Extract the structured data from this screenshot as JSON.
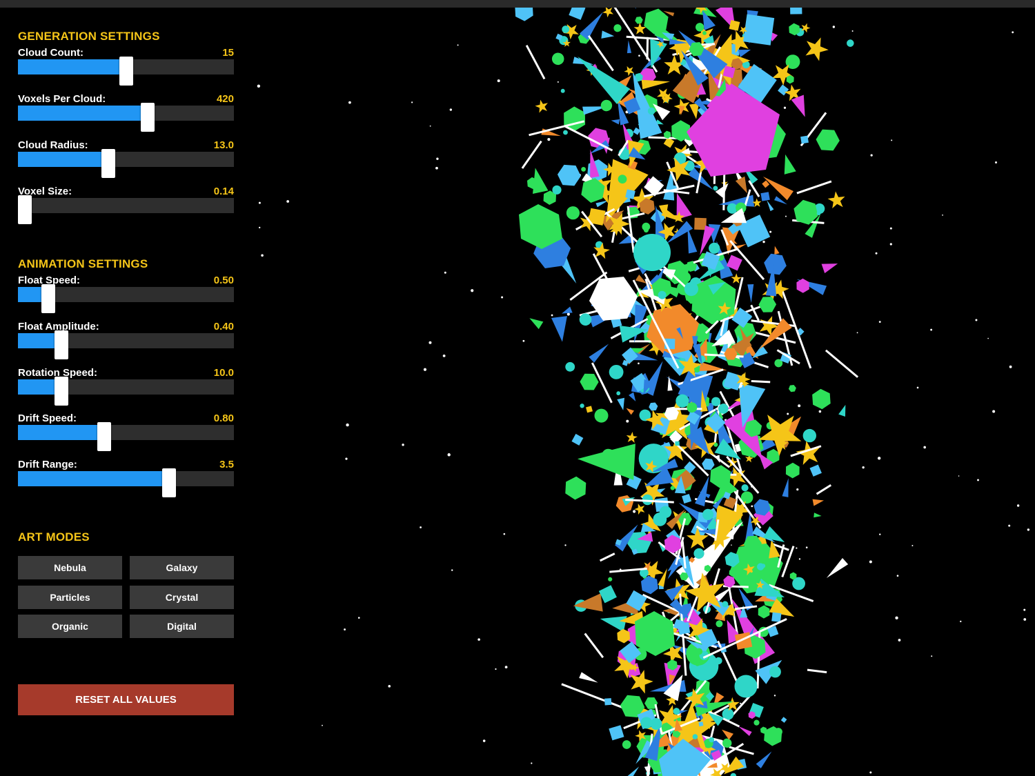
{
  "generation": {
    "title": "GENERATION SETTINGS",
    "sliders": [
      {
        "label": "Cloud Count:",
        "value": "15",
        "fraction": 0.5
      },
      {
        "label": "Voxels Per Cloud:",
        "value": "420",
        "fraction": 0.6
      },
      {
        "label": "Cloud Radius:",
        "value": "13.0",
        "fraction": 0.42
      },
      {
        "label": "Voxel Size:",
        "value": "0.14",
        "fraction": 0.02
      }
    ]
  },
  "animation": {
    "title": "ANIMATION SETTINGS",
    "sliders": [
      {
        "label": "Float Speed:",
        "value": "0.50",
        "fraction": 0.14
      },
      {
        "label": "Float Amplitude:",
        "value": "0.40",
        "fraction": 0.2
      },
      {
        "label": "Rotation Speed:",
        "value": "10.0",
        "fraction": 0.2
      },
      {
        "label": "Drift Speed:",
        "value": "0.80",
        "fraction": 0.4
      },
      {
        "label": "Drift Range:",
        "value": "3.5",
        "fraction": 0.7
      }
    ]
  },
  "art_modes": {
    "title": "ART MODES",
    "buttons": [
      "Nebula",
      "Galaxy",
      "Particles",
      "Crystal",
      "Organic",
      "Digital"
    ]
  },
  "reset_label": "RESET ALL VALUES",
  "scene": {
    "background": "#000000",
    "palette": [
      "#2ee05a",
      "#e040e0",
      "#4fc3f7",
      "#f28a2b",
      "#f5c518",
      "#2fd6c8",
      "#2e7fe0",
      "#c8792a",
      "#ffffff"
    ]
  },
  "colors": {
    "accent": "#f5c518",
    "slider_fill": "#2196f3",
    "reset": "#a63a2b"
  }
}
